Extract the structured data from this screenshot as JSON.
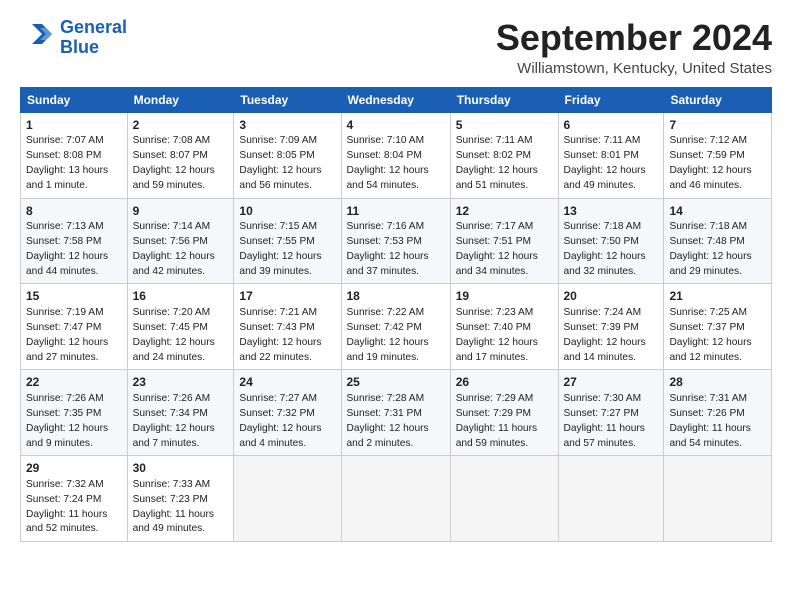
{
  "header": {
    "logo_line1": "General",
    "logo_line2": "Blue",
    "month_title": "September 2024",
    "location": "Williamstown, Kentucky, United States"
  },
  "weekdays": [
    "Sunday",
    "Monday",
    "Tuesday",
    "Wednesday",
    "Thursday",
    "Friday",
    "Saturday"
  ],
  "weeks": [
    [
      {
        "day": "1",
        "info": "Sunrise: 7:07 AM\nSunset: 8:08 PM\nDaylight: 13 hours\nand 1 minute."
      },
      {
        "day": "2",
        "info": "Sunrise: 7:08 AM\nSunset: 8:07 PM\nDaylight: 12 hours\nand 59 minutes."
      },
      {
        "day": "3",
        "info": "Sunrise: 7:09 AM\nSunset: 8:05 PM\nDaylight: 12 hours\nand 56 minutes."
      },
      {
        "day": "4",
        "info": "Sunrise: 7:10 AM\nSunset: 8:04 PM\nDaylight: 12 hours\nand 54 minutes."
      },
      {
        "day": "5",
        "info": "Sunrise: 7:11 AM\nSunset: 8:02 PM\nDaylight: 12 hours\nand 51 minutes."
      },
      {
        "day": "6",
        "info": "Sunrise: 7:11 AM\nSunset: 8:01 PM\nDaylight: 12 hours\nand 49 minutes."
      },
      {
        "day": "7",
        "info": "Sunrise: 7:12 AM\nSunset: 7:59 PM\nDaylight: 12 hours\nand 46 minutes."
      }
    ],
    [
      {
        "day": "8",
        "info": "Sunrise: 7:13 AM\nSunset: 7:58 PM\nDaylight: 12 hours\nand 44 minutes."
      },
      {
        "day": "9",
        "info": "Sunrise: 7:14 AM\nSunset: 7:56 PM\nDaylight: 12 hours\nand 42 minutes."
      },
      {
        "day": "10",
        "info": "Sunrise: 7:15 AM\nSunset: 7:55 PM\nDaylight: 12 hours\nand 39 minutes."
      },
      {
        "day": "11",
        "info": "Sunrise: 7:16 AM\nSunset: 7:53 PM\nDaylight: 12 hours\nand 37 minutes."
      },
      {
        "day": "12",
        "info": "Sunrise: 7:17 AM\nSunset: 7:51 PM\nDaylight: 12 hours\nand 34 minutes."
      },
      {
        "day": "13",
        "info": "Sunrise: 7:18 AM\nSunset: 7:50 PM\nDaylight: 12 hours\nand 32 minutes."
      },
      {
        "day": "14",
        "info": "Sunrise: 7:18 AM\nSunset: 7:48 PM\nDaylight: 12 hours\nand 29 minutes."
      }
    ],
    [
      {
        "day": "15",
        "info": "Sunrise: 7:19 AM\nSunset: 7:47 PM\nDaylight: 12 hours\nand 27 minutes."
      },
      {
        "day": "16",
        "info": "Sunrise: 7:20 AM\nSunset: 7:45 PM\nDaylight: 12 hours\nand 24 minutes."
      },
      {
        "day": "17",
        "info": "Sunrise: 7:21 AM\nSunset: 7:43 PM\nDaylight: 12 hours\nand 22 minutes."
      },
      {
        "day": "18",
        "info": "Sunrise: 7:22 AM\nSunset: 7:42 PM\nDaylight: 12 hours\nand 19 minutes."
      },
      {
        "day": "19",
        "info": "Sunrise: 7:23 AM\nSunset: 7:40 PM\nDaylight: 12 hours\nand 17 minutes."
      },
      {
        "day": "20",
        "info": "Sunrise: 7:24 AM\nSunset: 7:39 PM\nDaylight: 12 hours\nand 14 minutes."
      },
      {
        "day": "21",
        "info": "Sunrise: 7:25 AM\nSunset: 7:37 PM\nDaylight: 12 hours\nand 12 minutes."
      }
    ],
    [
      {
        "day": "22",
        "info": "Sunrise: 7:26 AM\nSunset: 7:35 PM\nDaylight: 12 hours\nand 9 minutes."
      },
      {
        "day": "23",
        "info": "Sunrise: 7:26 AM\nSunset: 7:34 PM\nDaylight: 12 hours\nand 7 minutes."
      },
      {
        "day": "24",
        "info": "Sunrise: 7:27 AM\nSunset: 7:32 PM\nDaylight: 12 hours\nand 4 minutes."
      },
      {
        "day": "25",
        "info": "Sunrise: 7:28 AM\nSunset: 7:31 PM\nDaylight: 12 hours\nand 2 minutes."
      },
      {
        "day": "26",
        "info": "Sunrise: 7:29 AM\nSunset: 7:29 PM\nDaylight: 11 hours\nand 59 minutes."
      },
      {
        "day": "27",
        "info": "Sunrise: 7:30 AM\nSunset: 7:27 PM\nDaylight: 11 hours\nand 57 minutes."
      },
      {
        "day": "28",
        "info": "Sunrise: 7:31 AM\nSunset: 7:26 PM\nDaylight: 11 hours\nand 54 minutes."
      }
    ],
    [
      {
        "day": "29",
        "info": "Sunrise: 7:32 AM\nSunset: 7:24 PM\nDaylight: 11 hours\nand 52 minutes."
      },
      {
        "day": "30",
        "info": "Sunrise: 7:33 AM\nSunset: 7:23 PM\nDaylight: 11 hours\nand 49 minutes."
      },
      {
        "day": "",
        "info": ""
      },
      {
        "day": "",
        "info": ""
      },
      {
        "day": "",
        "info": ""
      },
      {
        "day": "",
        "info": ""
      },
      {
        "day": "",
        "info": ""
      }
    ]
  ]
}
